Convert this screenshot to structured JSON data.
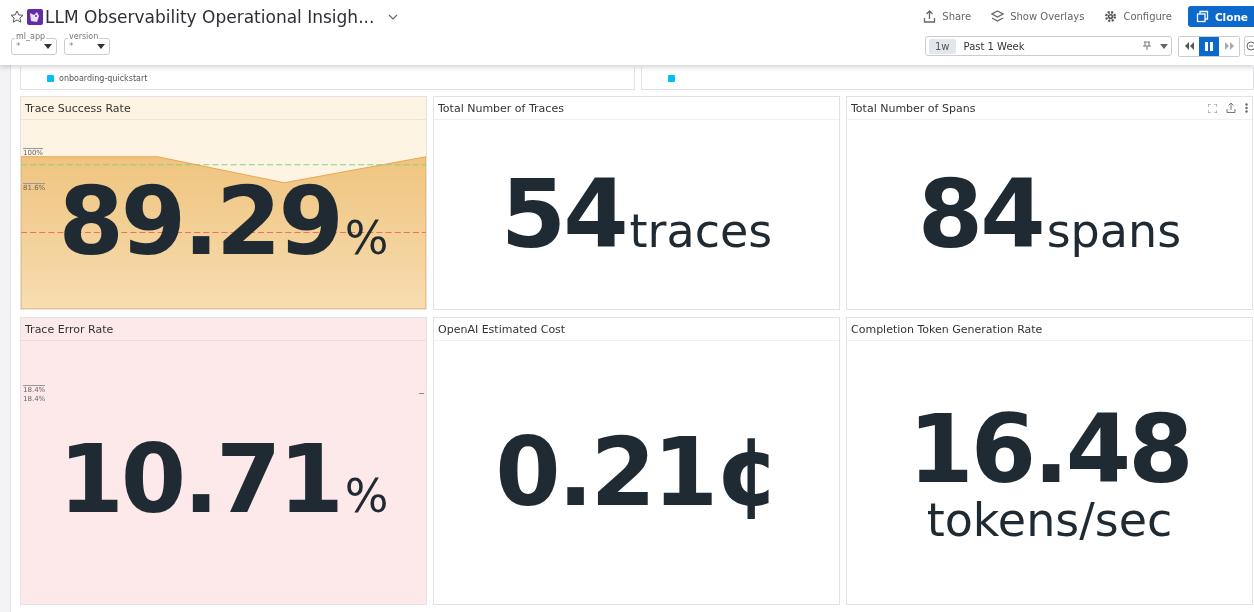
{
  "header": {
    "title": "LLM Observability Operational Insigh...",
    "starred": false,
    "actions": [
      {
        "kind": "share",
        "label": "Share"
      },
      {
        "kind": "overlays",
        "label": "Show Overlays"
      },
      {
        "kind": "configure",
        "label": "Configure"
      },
      {
        "kind": "clone",
        "label": "Clone"
      }
    ],
    "filters": [
      {
        "label": "ml_app",
        "value": "*"
      },
      {
        "label": "version",
        "value": "*"
      }
    ],
    "time": {
      "badge": "1w",
      "label": "Past 1 Week"
    },
    "playback": [
      {
        "kind": "back",
        "selected": false
      },
      {
        "kind": "pause",
        "selected": true
      },
      {
        "kind": "forward",
        "selected": false
      }
    ]
  },
  "legends": [
    {
      "items": [
        {
          "label": "onboarding-quickstart",
          "color": "#00bff3"
        }
      ]
    },
    {
      "items": [
        {
          "color": "#00bff3"
        }
      ]
    }
  ],
  "widgets": [
    {
      "title": "Trace Success Rate",
      "value": "89.29",
      "unit": "%",
      "kind": "success",
      "unit_below": false,
      "axis_labels": [
        "100%",
        "81.6%"
      ],
      "actions": false
    },
    {
      "title": "Total Number of Traces",
      "value": "54",
      "unit": "traces",
      "kind": "plain",
      "unit_below": false,
      "actions": false
    },
    {
      "title": "Total Number of Spans",
      "value": "84",
      "unit": "spans",
      "kind": "plain",
      "unit_below": false,
      "actions": true
    },
    {
      "title": "Trace Error Rate",
      "value": "10.71",
      "unit": "%",
      "kind": "error",
      "unit_below": false,
      "axis_labels": [
        "18.4%",
        "18.4%"
      ],
      "actions": false
    },
    {
      "title": "OpenAI Estimated Cost",
      "value": "0.21¢",
      "kind": "plain",
      "actions": false
    },
    {
      "title": "Completion Token Generation Rate",
      "value": "16.48",
      "unit": "tokens/sec",
      "kind": "plain",
      "unit_below": true,
      "actions": false
    }
  ]
}
